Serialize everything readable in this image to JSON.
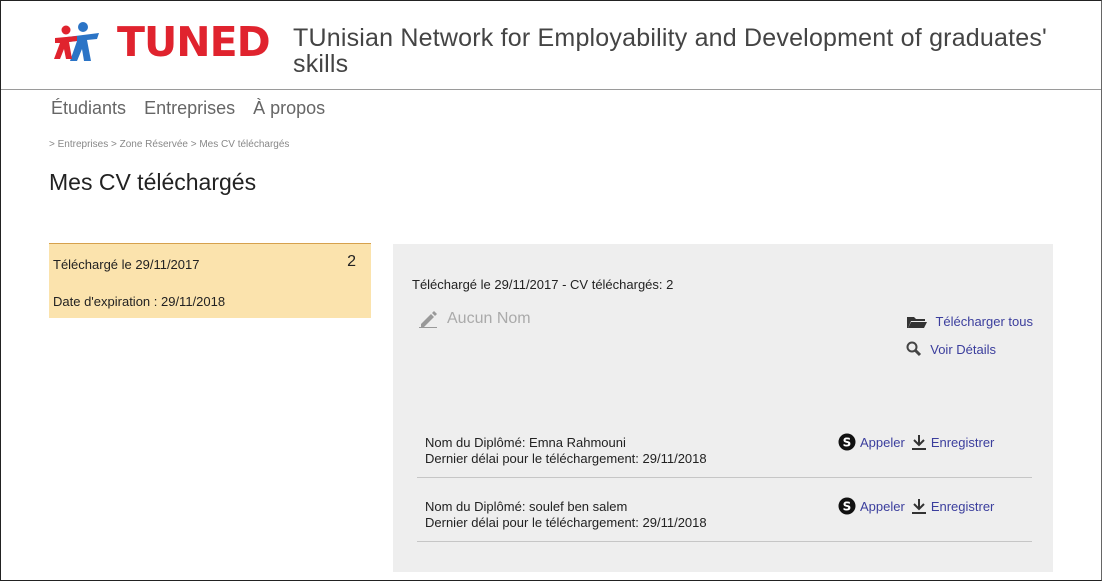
{
  "brand": {
    "logo_text": "TUNED",
    "tagline": "TUnisian Network for Employability and Development of graduates' skills",
    "color": "#e0232e"
  },
  "nav": {
    "items": [
      "Étudiants",
      "Entreprises",
      "À propos"
    ]
  },
  "breadcrumb": "> Entreprises > Zone Réservée > Mes CV téléchargés",
  "page_title": "Mes CV téléchargés",
  "left_card": {
    "date": "Téléchargé le 29/11/2017",
    "count": "2",
    "expiration": "Date d'expiration : 29/11/2018"
  },
  "panel": {
    "header": "Téléchargé le 29/11/2017 - CV téléchargés: 2",
    "aucun_nom": "Aucun Nom",
    "download_all": "Télécharger tous",
    "view_details": "Voir Détails"
  },
  "rows": [
    {
      "name": "Nom du Diplômé: Emna Rahmouni",
      "deadline": "Dernier délai pour le téléchargement: 29/11/2018",
      "call": "Appeler",
      "save": "Enregistrer"
    },
    {
      "name": "Nom du Diplômé: soulef ben salem",
      "deadline": "Dernier délai pour le téléchargement: 29/11/2018",
      "call": "Appeler",
      "save": "Enregistrer"
    }
  ],
  "colors": {
    "link": "#3b3e9d",
    "card_bg": "#fbe3ad",
    "panel_bg": "#eeeeee"
  },
  "icons": [
    "tuned-logo-icon",
    "pencil-icon",
    "folder-icon",
    "search-icon",
    "skype-icon",
    "download-icon"
  ]
}
